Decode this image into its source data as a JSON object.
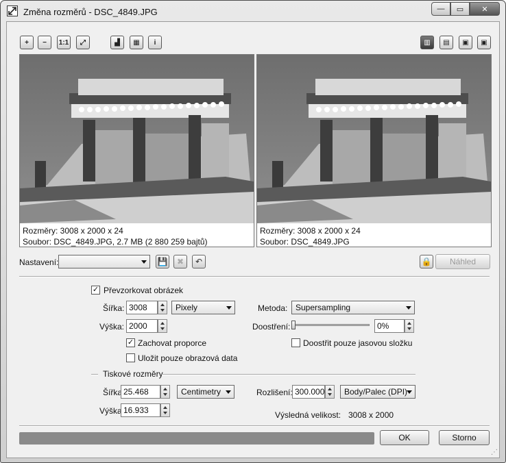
{
  "window": {
    "title": "Změna rozměrů - DSC_4849.JPG"
  },
  "titlebar_buttons": {
    "minimize": "—",
    "maximize": "▭",
    "close": "✕"
  },
  "toolbar": {
    "zoom_in": "+",
    "zoom_out": "−",
    "actual_size": "1:1",
    "fit": "⤢",
    "histogram": "▟",
    "compare": "▦",
    "info": "i"
  },
  "view_layouts": {
    "side_by_side": "▥",
    "top_bottom": "▤",
    "single_left": "▣",
    "single_right": "▣"
  },
  "preview_left": {
    "dimensions": "Rozměry: 3008 x 2000 x 24",
    "file": "Soubor: DSC_4849.JPG, 2.7 MB (2 880 259 bajtů)"
  },
  "preview_right": {
    "dimensions": "Rozměry: 3008 x 2000 x 24",
    "file": "Soubor: DSC_4849.JPG"
  },
  "settings": {
    "label": "Nastavení:",
    "value": "",
    "save_icon": "💾",
    "delete_icon": "✖",
    "reset_icon": "↶"
  },
  "preview_toggle": {
    "lock_icon": "🔒",
    "label": "Náhled"
  },
  "resample": {
    "checkbox_label": "Převzorkovat obrázek",
    "checked": true,
    "width_label": "Šířka:",
    "width_value": "3008",
    "height_label": "Výška:",
    "height_value": "2000",
    "unit": "Pixely",
    "keep_ratio_label": "Zachovat proporce",
    "keep_ratio_checked": true,
    "data_only_label": "Uložit pouze obrazová data",
    "data_only_checked": false,
    "method_label": "Metoda:",
    "method_value": "Supersampling",
    "sharpen_label": "Doostření:",
    "sharpen_value": "0%",
    "sharpen_level": 0,
    "luma_only_label": "Doostřit pouze jasovou složku",
    "luma_only_checked": false
  },
  "print": {
    "section_label": "Tiskové rozměry",
    "width_label": "Šířka:",
    "width_value": "25.468",
    "height_label": "Výška:",
    "height_value": "16.933",
    "unit": "Centimetry",
    "resolution_label": "Rozlišení:",
    "resolution_value": "300.000",
    "resolution_unit": "Body/Palec (DPI)",
    "result_label": "Výsledná velikost:",
    "result_value": "3008 x 2000"
  },
  "progress": {
    "value": 1.0
  },
  "buttons": {
    "ok": "OK",
    "cancel": "Storno"
  }
}
